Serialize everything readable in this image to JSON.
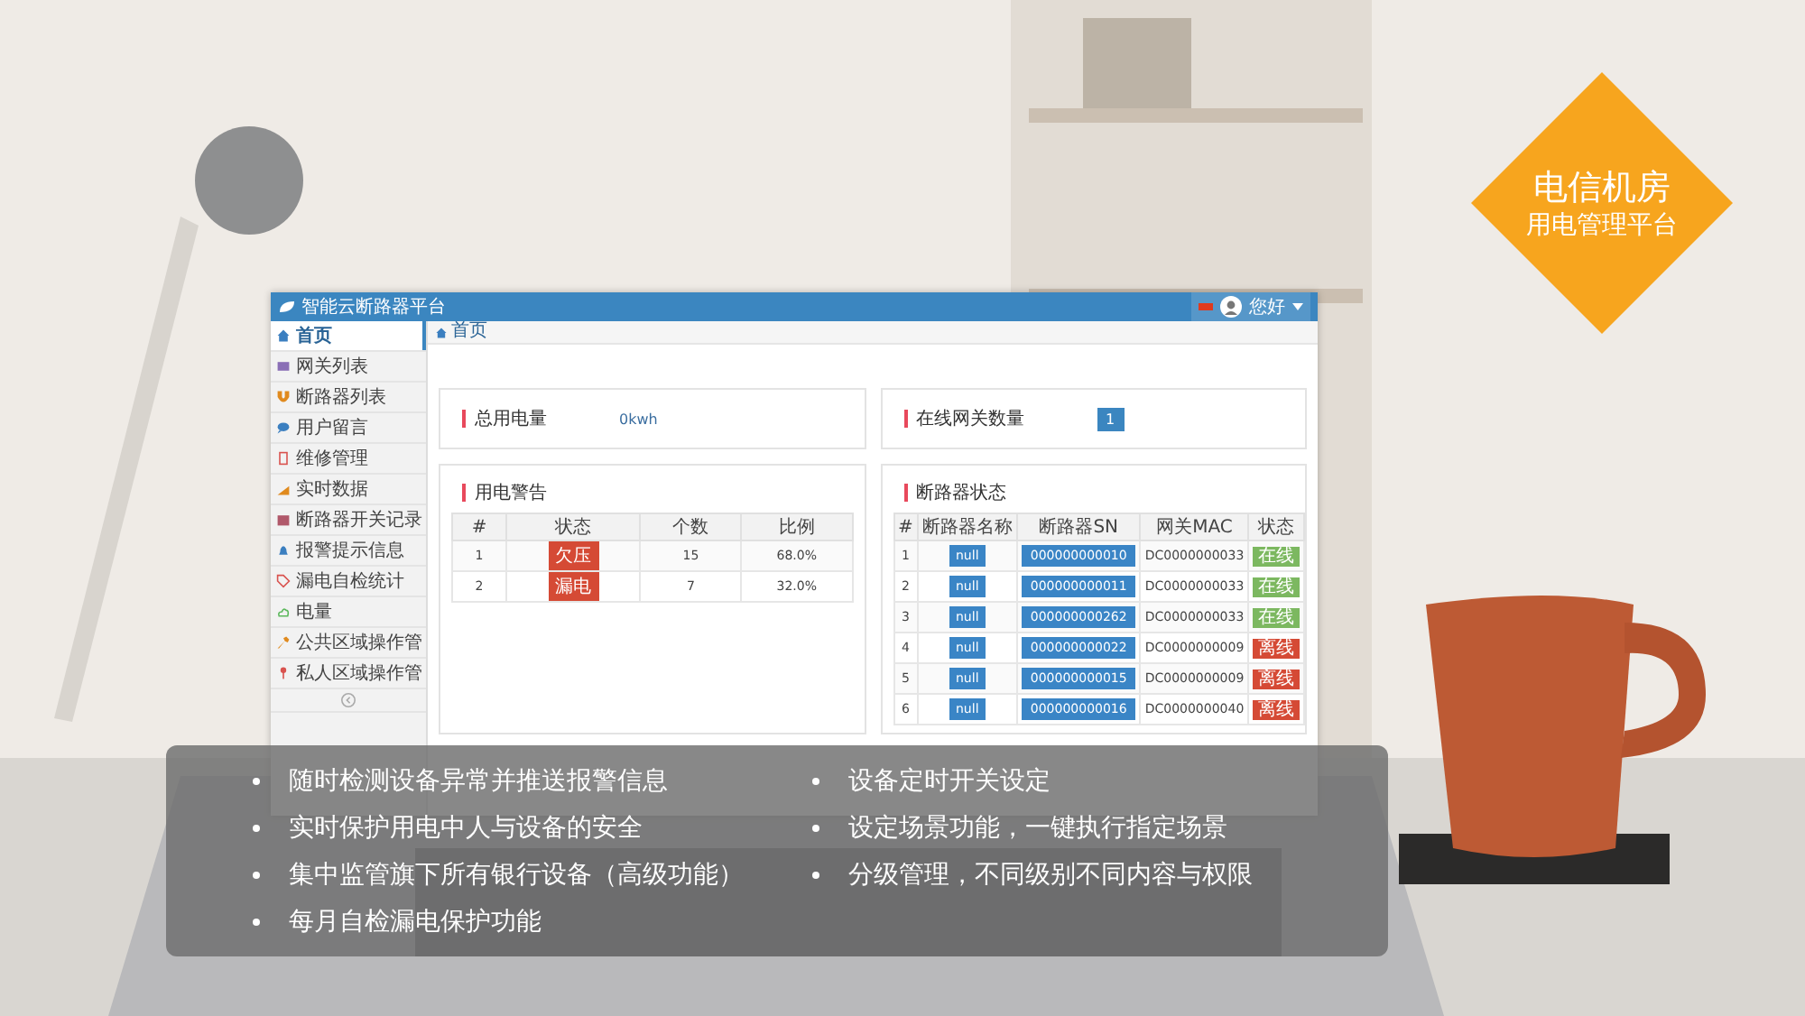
{
  "app": {
    "title": "智能云断路器平台",
    "user": "您好",
    "sidebar": {
      "items": [
        {
          "label": "首页",
          "selected": true
        },
        {
          "label": "网关列表",
          "selected": false
        },
        {
          "label": "断路器列表",
          "selected": false
        },
        {
          "label": "用户留言",
          "selected": false
        },
        {
          "label": "维修管理",
          "selected": false
        },
        {
          "label": "实时数据",
          "selected": false
        },
        {
          "label": "断路器开关记录",
          "selected": false
        },
        {
          "label": "报警提示信息",
          "selected": false
        },
        {
          "label": "漏电自检统计",
          "selected": false
        },
        {
          "label": "电量",
          "selected": false
        },
        {
          "label": "公共区域操作管",
          "selected": false
        },
        {
          "label": "私人区域操作管",
          "selected": false
        }
      ]
    },
    "breadcrumb": "首页",
    "stats": [
      {
        "label": "总用电量",
        "value": "0kwh",
        "kind": "text"
      },
      {
        "label": "在线网关数量",
        "value": "1",
        "kind": "badge"
      }
    ],
    "warnings": {
      "title": "用电警告",
      "columns": [
        "#",
        "状态",
        "个数",
        "比例"
      ],
      "rows": [
        [
          "1",
          "欠压",
          "15",
          "68.0%"
        ],
        [
          "2",
          "漏电",
          "7",
          "32.0%"
        ]
      ]
    },
    "breakers": {
      "title": "断路器状态",
      "columns": [
        "#",
        "断路器名称",
        "断路器SN",
        "网关MAC",
        "状态"
      ],
      "rows": [
        {
          "no": "1",
          "name": "null",
          "sn": "000000000010",
          "mac": "DC0000000033",
          "status": "在线",
          "online": true
        },
        {
          "no": "2",
          "name": "null",
          "sn": "000000000011",
          "mac": "DC0000000033",
          "status": "在线",
          "online": true
        },
        {
          "no": "3",
          "name": "null",
          "sn": "000000000262",
          "mac": "DC0000000033",
          "status": "在线",
          "online": true
        },
        {
          "no": "4",
          "name": "null",
          "sn": "000000000022",
          "mac": "DC0000000009",
          "status": "离线",
          "online": false
        },
        {
          "no": "5",
          "name": "null",
          "sn": "000000000015",
          "mac": "DC0000000009",
          "status": "离线",
          "online": false
        },
        {
          "no": "6",
          "name": "null",
          "sn": "000000000016",
          "mac": "DC0000000040",
          "status": "离线",
          "online": false
        }
      ]
    }
  },
  "badge": {
    "title": "电信机房",
    "subtitle": "用电管理平台"
  },
  "features": {
    "left": [
      "随时检测设备异常并推送报警信息",
      "实时保护用电中人与设备的安全",
      "集中监管旗下所有银行设备（高级功能）",
      "每月自检漏电保护功能"
    ],
    "right": [
      "设备定时开关设定",
      "设定场景功能，一键执行指定场景",
      "分级管理，不同级别不同内容与权限"
    ]
  }
}
